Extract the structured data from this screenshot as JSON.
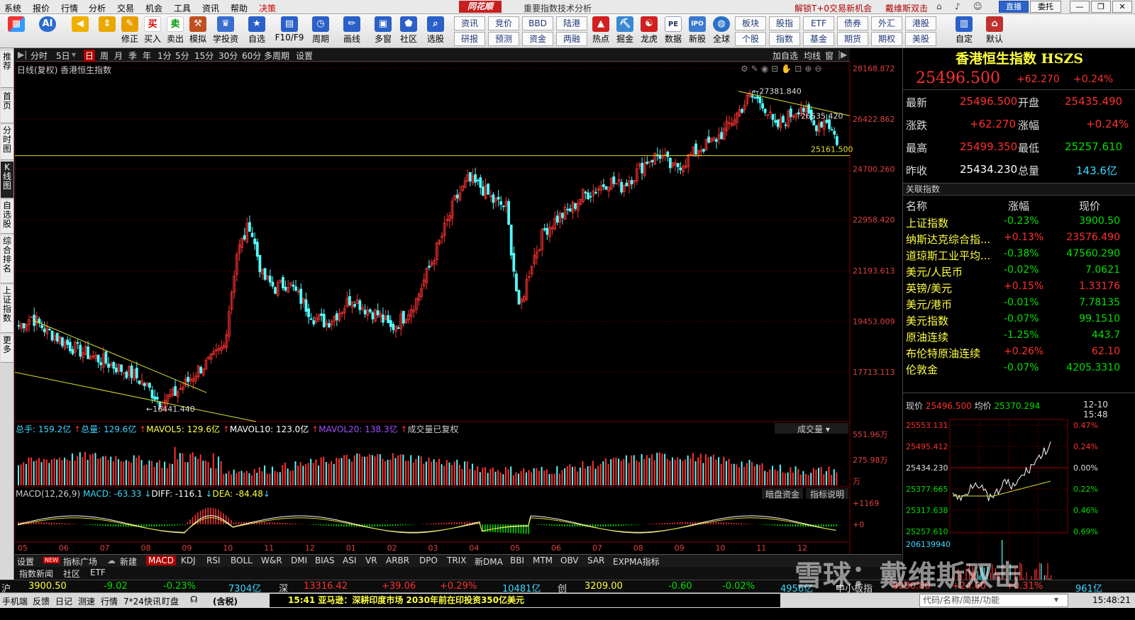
{
  "menu": {
    "items": [
      "系统",
      "报价",
      "行情",
      "分析",
      "交易",
      "机会",
      "工具",
      "资讯",
      "帮助",
      "决策"
    ],
    "logo": "同花顺",
    "window_title": "重要指数技术分析",
    "promo1": "解锁T+0交易新机会",
    "promo2": "戴维斯双击",
    "live": "直播",
    "consign": "委托"
  },
  "toolbar": {
    "buttons": [
      "修正",
      "买入",
      "卖出",
      "模拟",
      "学投资",
      "自选",
      "F10/F9",
      "周期",
      "画线",
      "多窗",
      "社区",
      "选股",
      "热点",
      "掘金",
      "龙虎",
      "数据",
      "新股",
      "全球",
      "自定",
      "默认"
    ],
    "small_top": [
      "资讯",
      "竞价",
      "BBD",
      "陆港",
      "板块",
      "股指",
      "ETF",
      "债券",
      "外汇",
      "港股"
    ],
    "small_bottom": [
      "研报",
      "预测",
      "资金",
      "两融",
      "个股",
      "指数",
      "基金",
      "期货",
      "期权",
      "美股"
    ]
  },
  "left_tabs": [
    "推荐",
    "首页",
    "分时图",
    "K线图",
    "自选股",
    "综合排名",
    "上证指数",
    "更多"
  ],
  "period_tabs": [
    "分时",
    "5日",
    "日",
    "周",
    "月",
    "季",
    "年",
    "1分",
    "5分",
    "15分",
    "30分",
    "60分",
    "多周期",
    "设置"
  ],
  "chart_tools_right": [
    "加自选",
    "均线",
    "窗"
  ],
  "chart_header": "日线(复权) 香港恒生指数",
  "chart_data": {
    "type": "candlestick",
    "title": "香港恒生指数",
    "y_ticks": [
      "28168.872",
      "26422.862",
      "24700.260",
      "22958.420",
      "21193.613",
      "19453.009",
      "17713.113"
    ],
    "x_ticks": [
      "05",
      "06",
      "07",
      "08",
      "09",
      "10",
      "11",
      "12",
      "01",
      "02",
      "03",
      "04",
      "05",
      "06",
      "07",
      "08",
      "09",
      "10",
      "11",
      "12"
    ],
    "ylim": [
      16000,
      28400
    ],
    "annotations": {
      "high": "27381.840",
      "low": "16441.440",
      "right_mark": "26535.420",
      "level": "25161.500"
    },
    "weekly_close": [
      19300,
      19600,
      19200,
      18900,
      18600,
      18400,
      18200,
      18000,
      17800,
      17600,
      17200,
      16700,
      16900,
      17300,
      17800,
      18100,
      18600,
      21800,
      22800,
      21000,
      20600,
      20800,
      20200,
      19600,
      19400,
      19800,
      20300,
      19900,
      19700,
      19200,
      19600,
      20200,
      21300,
      22400,
      23600,
      24300,
      24100,
      23600,
      23400,
      19800,
      21500,
      22600,
      23000,
      23300,
      23800,
      24000,
      24300,
      24100,
      24500,
      25000,
      25200,
      24700,
      25000,
      25400,
      25600,
      26000,
      26600,
      27200,
      27000,
      26100,
      26500,
      26900,
      26200,
      26400,
      25500
    ],
    "volume_ticks": [
      "551.96万",
      "275.98万",
      "万"
    ],
    "macd_ticks": [
      "+1169",
      "+0"
    ]
  },
  "volume_legend": {
    "a": "总手: 159.2亿",
    "b": "总量: 129.6亿",
    "c": "MAVOL5: 129.6亿",
    "d": "MAVOL10: 123.0亿",
    "e": "MAVOL20: 138.3亿",
    "f": "成交量已复权",
    "dd": "成交量"
  },
  "macd_legend": {
    "a": "MACD(12,26,9)",
    "b": "MACD: -63.33",
    "c": "DIFF: -116.1",
    "d": "DEA: -84.48",
    "btn1": "暗盘资金",
    "btn2": "指标说明"
  },
  "indicator_tabs": [
    "设置",
    "指标广场",
    "新建",
    "MACD",
    "KDJ",
    "RSI",
    "BOLL",
    "W&R",
    "DMI",
    "BIAS",
    "ASI",
    "VR",
    "ARBR",
    "DPO",
    "TRIX",
    "新DMA",
    "BBI",
    "MTM",
    "OBV",
    "SAR",
    "EXPMA指标"
  ],
  "new_badge": "NEW",
  "sub_tabs": [
    "指数新闻",
    "社区",
    "ETF"
  ],
  "quote": {
    "title": "香港恒生指数 HSZS",
    "price": "25496.500",
    "change": "+62.270",
    "pct": "+0.24%",
    "rows": [
      {
        "l1": "最新",
        "v1": "25496.500",
        "l2": "开盘",
        "v2": "25435.490"
      },
      {
        "l1": "涨跌",
        "v1": "+62.270",
        "l2": "涨幅",
        "v2": "+0.24%"
      },
      {
        "l1": "最高",
        "v1": "25499.350",
        "l2": "最低",
        "v2": "25257.610"
      },
      {
        "l1": "昨收",
        "v1": "25434.230",
        "l2": "总量",
        "v2": "143.6亿"
      }
    ]
  },
  "related": {
    "title": "关联指数",
    "headers": [
      "名称",
      "涨幅",
      "现价"
    ],
    "items": [
      {
        "name": "上证指数",
        "pct": "-0.23%",
        "price": "3900.50"
      },
      {
        "name": "纳斯达克综合指...",
        "pct": "+0.13%",
        "price": "23576.490"
      },
      {
        "name": "道琼斯工业平均...",
        "pct": "-0.38%",
        "price": "47560.290"
      },
      {
        "name": "美元/人民币",
        "pct": "-0.02%",
        "price": "7.0621"
      },
      {
        "name": "英镑/美元",
        "pct": "+0.15%",
        "price": "1.33176"
      },
      {
        "name": "美元/港币",
        "pct": "-0.01%",
        "price": "7.78135"
      },
      {
        "name": "美元指数",
        "pct": "-0.07%",
        "price": "99.1510"
      },
      {
        "name": "原油连续",
        "pct": "-1.25%",
        "price": "443.7"
      },
      {
        "name": "布伦特原油连续",
        "pct": "+0.26%",
        "price": "62.10"
      },
      {
        "name": "伦敦金",
        "pct": "-0.07%",
        "price": "4205.3310"
      }
    ]
  },
  "mini": {
    "now_label": "现价",
    "now": "25496.500",
    "avg_label": "均价",
    "avg": "25370.294",
    "time": "12-10 15:48",
    "left_ticks": [
      "25553.131",
      "25495.412",
      "25434.230",
      "25377.665",
      "25317.638",
      "25257.610"
    ],
    "right_ticks": [
      "0.47%",
      "0.24%",
      "0.00%",
      "0.22%",
      "0.46%",
      "0.69%"
    ],
    "vol_tick": "206139940"
  },
  "ticker": {
    "sh_label": "沪",
    "sh": "3900.50",
    "sh_chg": "-9.02",
    "sh_pct": "-0.23%",
    "sh_vol": "7304亿",
    "sz_label": "深",
    "sz": "13316.42",
    "sz_chg": "+39.06",
    "sz_pct": "+0.29%",
    "sz_vol": "10481亿",
    "cy_label": "创",
    "cy": "3209.00",
    "cy_chg": "-0.60",
    "cy_pct": "-0.02%",
    "cy_vol": "4956亿",
    "zx_label": "中小板指",
    "zx": "8030.80",
    "zx_chg": "+24.60",
    "zx_pct": "+0.31%",
    "zx_vol": "961亿"
  },
  "status": {
    "items": [
      "手机端",
      "反馈",
      "日记",
      "测速",
      "行情",
      "7*24快讯",
      "盯盘"
    ],
    "tax": "(含税)",
    "news": "15:41 亚马逊：深耕印度市场 2030年前在印投资350亿美元",
    "search": "代码/名称/简拼/功能",
    "clock": "15:48:21"
  },
  "watermark": "雪球：戴维斯双击"
}
